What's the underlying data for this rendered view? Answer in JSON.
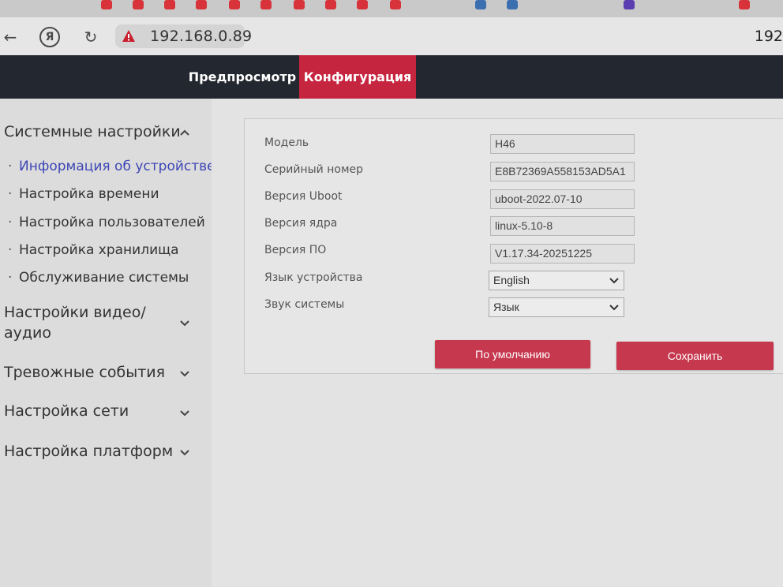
{
  "browser": {
    "url": "192.168.0.89",
    "url_right": "192"
  },
  "header": {
    "tabs": [
      {
        "label": "Предпросмотр"
      },
      {
        "label": "Конфигурация"
      }
    ]
  },
  "sidebar": {
    "system_settings": {
      "label": "Системные настройки",
      "items": [
        {
          "label": "Информация об устройстве"
        },
        {
          "label": "Настройка времени"
        },
        {
          "label": "Настройка пользователей"
        },
        {
          "label": "Настройка хранилища"
        },
        {
          "label": "Обслуживание системы"
        }
      ]
    },
    "video_audio": {
      "label_line1": "Настройки видео/",
      "label_line2": "аудио"
    },
    "alarm_events": {
      "label": "Тревожные события"
    },
    "network": {
      "label": "Настройка сети"
    },
    "platform": {
      "label": "Настройка платформ"
    }
  },
  "device_info": {
    "model_label": "Модель",
    "model_value": "H46",
    "serial_label": "Серийный номер",
    "serial_value": "E8B72369A558153AD5A1",
    "uboot_label": "Версия Uboot",
    "uboot_value": "uboot-2022.07-10",
    "kernel_label": "Версия ядра",
    "kernel_value": "linux-5.10-8",
    "firmware_label": "Версия ПО",
    "firmware_value": "V1.17.34-20251225",
    "language_label": "Язык устройства",
    "language_value": "English",
    "sound_label": "Звук системы",
    "sound_value": "Язык",
    "default_button": "По умолчанию",
    "save_button": "Сохранить"
  },
  "colors": {
    "accent": "#c6253f",
    "header_bg": "#23272f",
    "active_link": "#3d46b5"
  }
}
